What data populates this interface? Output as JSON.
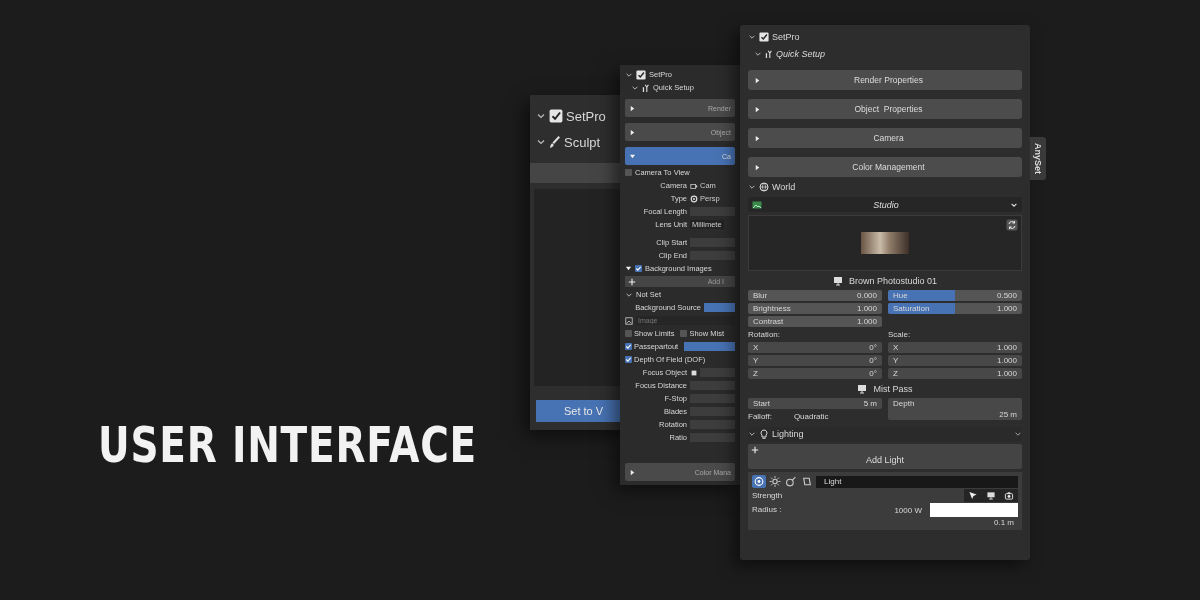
{
  "headline": "USER INTERFACE",
  "back_panel": {
    "addon": {
      "label": "SetPro",
      "expanded": true,
      "checked": true
    },
    "mode": {
      "label": "Sculpt",
      "expanded": true
    },
    "button": "Set to V"
  },
  "middle_panel": {
    "addon": {
      "label": "SetPro",
      "expanded": true,
      "checked": true
    },
    "section": {
      "label": "Quick Setup",
      "expanded": true
    },
    "headers": [
      {
        "label": "Render",
        "expanded": false
      },
      {
        "label": "Object",
        "expanded": false
      },
      {
        "label": "Ca",
        "expanded": true
      }
    ],
    "camera_to_view": {
      "label": "Camera To View",
      "checked": false
    },
    "properties": [
      {
        "label": "Camera",
        "value": "Cam",
        "kind": "object"
      },
      {
        "label": "Type",
        "value": "Persp",
        "kind": "radio"
      },
      {
        "label": "Focal Length",
        "kind": "number"
      },
      {
        "label": "Lens Unit",
        "value": "Millimete",
        "kind": "menu"
      },
      {
        "label": "Clip Start",
        "kind": "number"
      },
      {
        "label": "Clip End",
        "kind": "number"
      }
    ],
    "background_images": {
      "label": "Background Images",
      "checked": true,
      "expanded": true,
      "add_label": "Add I"
    },
    "image_slot": {
      "label": "Not Set",
      "expanded": true,
      "source_label": "Background Source",
      "image_placeholder": "Image"
    },
    "toggles": [
      {
        "label": "Show Limits",
        "checked": false,
        "kind": "check"
      },
      {
        "label": "Show Mist",
        "checked": false,
        "kind": "check"
      },
      {
        "label": "Passepartout",
        "checked": true,
        "kind": "check_slider",
        "level": 1
      },
      {
        "label": "Depth Of Field (DOF)",
        "checked": true,
        "kind": "check"
      }
    ],
    "dof_properties": [
      {
        "label": "Focus Object",
        "kind": "object"
      },
      {
        "label": "Focus Distance",
        "kind": "number"
      },
      {
        "label": "F-Stop",
        "kind": "number"
      },
      {
        "label": "Blades",
        "kind": "number"
      },
      {
        "label": "Rotation",
        "kind": "number"
      },
      {
        "label": "Ratio",
        "kind": "number"
      }
    ],
    "footer_header": {
      "label": "Color Mana",
      "expanded": false
    }
  },
  "front_panel": {
    "addon": {
      "label": "SetPro",
      "expanded": true,
      "checked": true
    },
    "section": {
      "label": "Quick Setup",
      "expanded": true
    },
    "headers": [
      {
        "label": "Render Properties",
        "expanded": false
      },
      {
        "label": "Object  Properties",
        "expanded": false
      },
      {
        "label": "Camera",
        "expanded": false
      },
      {
        "label": "Color Management",
        "expanded": false
      }
    ],
    "world": {
      "label": "World",
      "expanded": true
    },
    "hdri": {
      "selector": "Studio",
      "name": "Brown Photostudio 01"
    },
    "left_sliders": [
      {
        "label": "Blur",
        "value": "0.000"
      },
      {
        "label": "Brightness",
        "value": "1.000"
      },
      {
        "label": "Contrast",
        "value": "1.000"
      }
    ],
    "right_sliders": [
      {
        "label": "Hue",
        "value": "0.500",
        "level": 0.5
      },
      {
        "label": "Saturation",
        "value": "1.000",
        "level": 0.5
      }
    ],
    "rotation": {
      "label": "Rotation:",
      "axes": [
        {
          "axis": "X",
          "value": "0°"
        },
        {
          "axis": "Y",
          "value": "0°"
        },
        {
          "axis": "Z",
          "value": "0°"
        }
      ]
    },
    "scale": {
      "label": "Scale:",
      "axes": [
        {
          "axis": "X",
          "value": "1.000"
        },
        {
          "axis": "Y",
          "value": "1.000"
        },
        {
          "axis": "Z",
          "value": "1.000"
        }
      ]
    },
    "mist": {
      "title": "Mist Pass",
      "start_label": "Start",
      "start": "5 m",
      "depth_label": "Depth",
      "depth": "25 m",
      "falloff_label": "Falloff:",
      "falloff": "Quadratic"
    },
    "lighting": {
      "label": "Lighting",
      "expanded": true,
      "add_label": "Add Light",
      "light_types": [
        {
          "kind": "point",
          "selected": true
        },
        {
          "kind": "sun",
          "selected": false
        },
        {
          "kind": "spot",
          "selected": false
        },
        {
          "kind": "area",
          "selected": false
        }
      ],
      "light_name": "Light",
      "strength_label": "Strength",
      "strength": "1000 W",
      "radius_label": "Radius :",
      "radius": "0.1 m",
      "color": "#ffffff",
      "tools": [
        {
          "kind": "cursor"
        },
        {
          "kind": "monitor"
        },
        {
          "kind": "camera"
        }
      ]
    }
  },
  "side_tab": "AnySet"
}
